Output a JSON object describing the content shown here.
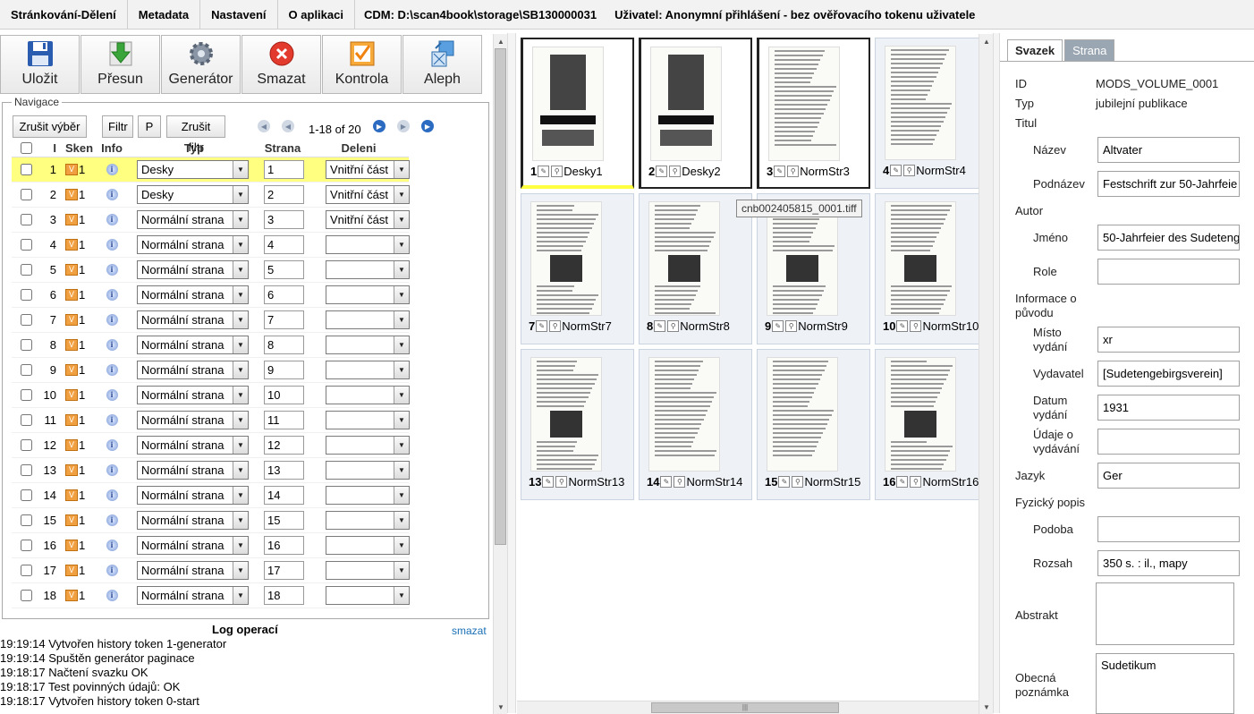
{
  "menu": {
    "items": [
      "Stránkování-Dělení",
      "Metadata",
      "Nastavení",
      "O aplikaci"
    ],
    "cdm": "CDM: D:\\scan4book\\storage\\SB130000031",
    "user": "Uživatel: Anonymní přihlášení - bez ověřovacího tokenu uživatele"
  },
  "toolbar": {
    "save": "Uložit",
    "move": "Přesun",
    "generator": "Generátor",
    "delete": "Smazat",
    "check": "Kontrola",
    "aleph": "Aleph"
  },
  "nav": {
    "legend": "Navigace",
    "clear_selection": "Zrušit výběr",
    "filter": "Filtr",
    "p": "P",
    "clear_filter": "Zrušit filtr",
    "pager": "1-18 of 20",
    "headers": {
      "i": "I",
      "sken": "Sken",
      "info": "Info",
      "typ": "Typ",
      "strana": "Strana",
      "deleni": "Deleni"
    },
    "rows": [
      {
        "i": "1",
        "sken": "1",
        "typ": "Desky",
        "strana": "1",
        "deleni": "Vnitřní část"
      },
      {
        "i": "2",
        "sken": "1",
        "typ": "Desky",
        "strana": "2",
        "deleni": "Vnitřní část"
      },
      {
        "i": "3",
        "sken": "1",
        "typ": "Normální strana",
        "strana": "3",
        "deleni": "Vnitřní část"
      },
      {
        "i": "4",
        "sken": "1",
        "typ": "Normální strana",
        "strana": "4",
        "deleni": ""
      },
      {
        "i": "5",
        "sken": "1",
        "typ": "Normální strana",
        "strana": "5",
        "deleni": ""
      },
      {
        "i": "6",
        "sken": "1",
        "typ": "Normální strana",
        "strana": "6",
        "deleni": ""
      },
      {
        "i": "7",
        "sken": "1",
        "typ": "Normální strana",
        "strana": "7",
        "deleni": ""
      },
      {
        "i": "8",
        "sken": "1",
        "typ": "Normální strana",
        "strana": "8",
        "deleni": ""
      },
      {
        "i": "9",
        "sken": "1",
        "typ": "Normální strana",
        "strana": "9",
        "deleni": ""
      },
      {
        "i": "10",
        "sken": "1",
        "typ": "Normální strana",
        "strana": "10",
        "deleni": ""
      },
      {
        "i": "11",
        "sken": "1",
        "typ": "Normální strana",
        "strana": "11",
        "deleni": ""
      },
      {
        "i": "12",
        "sken": "1",
        "typ": "Normální strana",
        "strana": "12",
        "deleni": ""
      },
      {
        "i": "13",
        "sken": "1",
        "typ": "Normální strana",
        "strana": "13",
        "deleni": ""
      },
      {
        "i": "14",
        "sken": "1",
        "typ": "Normální strana",
        "strana": "14",
        "deleni": ""
      },
      {
        "i": "15",
        "sken": "1",
        "typ": "Normální strana",
        "strana": "15",
        "deleni": ""
      },
      {
        "i": "16",
        "sken": "1",
        "typ": "Normální strana",
        "strana": "16",
        "deleni": ""
      },
      {
        "i": "17",
        "sken": "1",
        "typ": "Normální strana",
        "strana": "17",
        "deleni": ""
      },
      {
        "i": "18",
        "sken": "1",
        "typ": "Normální strana",
        "strana": "18",
        "deleni": ""
      }
    ]
  },
  "log": {
    "title": "Log operací",
    "clear": "smazat",
    "lines": [
      "19:19:14 Vytvořen history token 1-generator",
      "19:19:14 Spuštěn generátor paginace",
      "19:18:17 Načtení svazku OK",
      "19:18:17 Test povinných údajů: OK",
      "19:18:17 Vytvořen history token 0-start"
    ]
  },
  "thumbs": [
    {
      "num": "1",
      "label": "Desky1"
    },
    {
      "num": "2",
      "label": "Desky2"
    },
    {
      "num": "3",
      "label": "NormStr3"
    },
    {
      "num": "4",
      "label": "NormStr4"
    },
    {
      "num": "7",
      "label": "NormStr7"
    },
    {
      "num": "8",
      "label": "NormStr8"
    },
    {
      "num": "9",
      "label": "NormStr9"
    },
    {
      "num": "10",
      "label": "NormStr10"
    },
    {
      "num": "13",
      "label": "NormStr13"
    },
    {
      "num": "14",
      "label": "NormStr14"
    },
    {
      "num": "15",
      "label": "NormStr15"
    },
    {
      "num": "16",
      "label": "NormStr16"
    }
  ],
  "tooltip": "cnb002405815_0001.tiff",
  "meta": {
    "tabs": [
      "Svazek",
      "Strana"
    ],
    "id_label": "ID",
    "id_value": "MODS_VOLUME_0001",
    "typ_label": "Typ",
    "typ_value": "jubilejní publikace",
    "titul": "Titul",
    "nazev_label": "Název",
    "nazev_value": "Altvater",
    "podnazev_label": "Podnázev",
    "podnazev_value": "Festschrift zur 50-Jahrfeie",
    "autor": "Autor",
    "jmeno_label": "Jméno",
    "jmeno_value": "50-Jahrfeier des Sudeteng",
    "role_label": "Role",
    "role_value": "",
    "puvod": "Informace o původu",
    "misto_label": "Místo vydání",
    "misto_value": "xr",
    "vydavatel_label": "Vydavatel",
    "vydavatel_value": "[Sudetengebirgsverein]",
    "datum_label": "Datum vydání",
    "datum_value": "1931",
    "udaje_label": "Údaje o vydávání",
    "udaje_value": "",
    "jazyk_label": "Jazyk",
    "jazyk_value": "Ger",
    "fyzicky": "Fyzický popis",
    "podoba_label": "Podoba",
    "podoba_value": "",
    "rozsah_label": "Rozsah",
    "rozsah_value": "350 s. : il., mapy",
    "abstrakt_label": "Abstrakt",
    "abstrakt_value": "",
    "poznamka_label": "Obecná poznámka",
    "poznamka_value": "Sudetikum"
  },
  "colors": {
    "selected_row": "#ffff80",
    "tab_inactive": "#9aa6b2",
    "link": "#1a6fb5"
  }
}
